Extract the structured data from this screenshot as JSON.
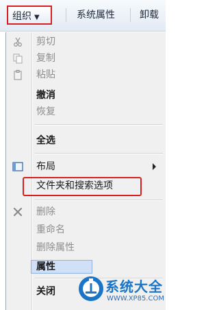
{
  "toolbar": {
    "organize_label": "组织",
    "system_properties_label": "系统属性",
    "uninstall_label": "卸载"
  },
  "menu": {
    "cut": "剪切",
    "copy": "复制",
    "paste": "粘贴",
    "undo": "撤消",
    "redo": "恢复",
    "select_all": "全选",
    "layout": "布局",
    "folder_options": "文件夹和搜索选项",
    "delete": "删除",
    "rename": "重命名",
    "remove_properties": "删除属性",
    "properties": "属性",
    "close": "关闭"
  },
  "watermark": {
    "title": "系统大全",
    "url": "WWW.XP85.COM"
  },
  "colors": {
    "highlight_border": "#d81e1e",
    "watermark_blue": "#1a74c8"
  }
}
